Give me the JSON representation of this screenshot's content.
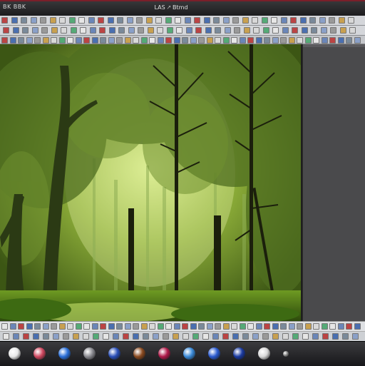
{
  "window": {
    "app_label": "BK BBK",
    "title": "LAS 🡕 Btmd",
    "accent_color": "#7a1f2a"
  },
  "toolbars": {
    "top_rows": 3,
    "icon_set": "image-editor-tools"
  },
  "canvas": {
    "content": "forest-image",
    "dominant_colors": [
      "#6f8f2a",
      "#2e3f12",
      "#c7e07a"
    ]
  },
  "side_panel": {
    "background": "#4a4a4c"
  },
  "dock": {
    "items": [
      {
        "name": "play-icon",
        "color": "#e8e8e8"
      },
      {
        "name": "flag-icon",
        "color": "#d04860"
      },
      {
        "name": "globe-icon",
        "color": "#2a6fd8"
      },
      {
        "name": "disk-icon",
        "color": "#8a8a90"
      },
      {
        "name": "sphere-icon",
        "color": "#2a4fb8"
      },
      {
        "name": "brown-ball-icon",
        "color": "#8a4a20"
      },
      {
        "name": "magenta-ball-icon",
        "color": "#b01a4a"
      },
      {
        "name": "pen-icon",
        "color": "#3a8ad8"
      },
      {
        "name": "blue-ball-icon",
        "color": "#2a5ad0"
      },
      {
        "name": "dark-blue-ball-icon",
        "color": "#1a3aa0"
      },
      {
        "name": "silver-ball-icon",
        "color": "#d8d8d8"
      },
      {
        "name": "dot-icon",
        "color": "#888888"
      }
    ]
  }
}
